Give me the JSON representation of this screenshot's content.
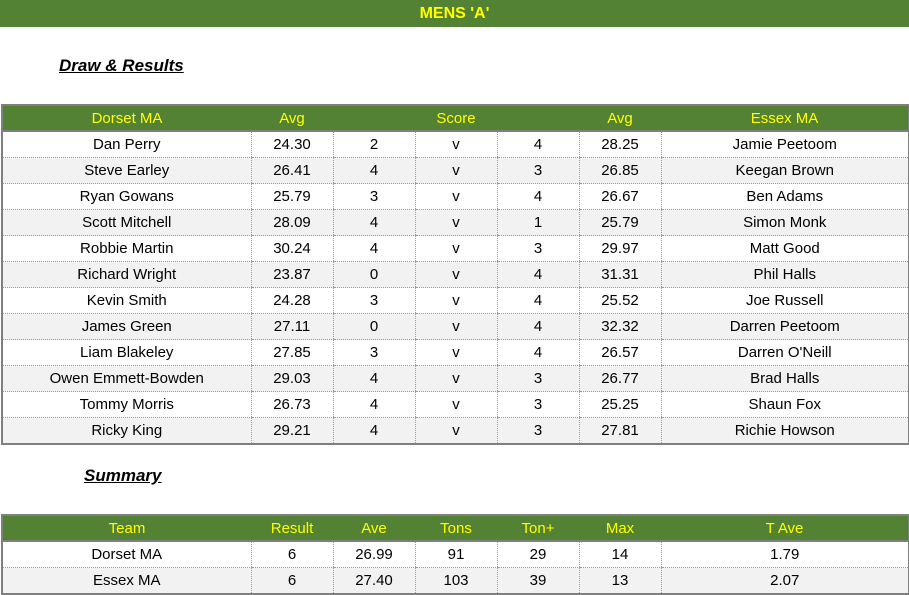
{
  "title": "MENS 'A'",
  "draw_heading": "Draw & Results",
  "summary_heading": "Summary",
  "draw": {
    "headers": [
      "Dorset MA",
      "Avg",
      "Score",
      "Avg",
      "Essex MA"
    ],
    "rows": [
      {
        "home": "Dan Perry",
        "home_avg": "24.30",
        "home_score": "2",
        "v": "v",
        "away_score": "4",
        "away_avg": "28.25",
        "away": "Jamie Peetoom"
      },
      {
        "home": "Steve Earley",
        "home_avg": "26.41",
        "home_score": "4",
        "v": "v",
        "away_score": "3",
        "away_avg": "26.85",
        "away": "Keegan Brown"
      },
      {
        "home": "Ryan Gowans",
        "home_avg": "25.79",
        "home_score": "3",
        "v": "v",
        "away_score": "4",
        "away_avg": "26.67",
        "away": "Ben Adams"
      },
      {
        "home": "Scott Mitchell",
        "home_avg": "28.09",
        "home_score": "4",
        "v": "v",
        "away_score": "1",
        "away_avg": "25.79",
        "away": "Simon Monk"
      },
      {
        "home": "Robbie Martin",
        "home_avg": "30.24",
        "home_score": "4",
        "v": "v",
        "away_score": "3",
        "away_avg": "29.97",
        "away": "Matt Good"
      },
      {
        "home": "Richard Wright",
        "home_avg": "23.87",
        "home_score": "0",
        "v": "v",
        "away_score": "4",
        "away_avg": "31.31",
        "away": "Phil Halls"
      },
      {
        "home": "Kevin Smith",
        "home_avg": "24.28",
        "home_score": "3",
        "v": "v",
        "away_score": "4",
        "away_avg": "25.52",
        "away": "Joe Russell"
      },
      {
        "home": "James Green",
        "home_avg": "27.11",
        "home_score": "0",
        "v": "v",
        "away_score": "4",
        "away_avg": "32.32",
        "away": "Darren Peetoom"
      },
      {
        "home": "Liam Blakeley",
        "home_avg": "27.85",
        "home_score": "3",
        "v": "v",
        "away_score": "4",
        "away_avg": "26.57",
        "away": "Darren O'Neill"
      },
      {
        "home": "Owen Emmett-Bowden",
        "home_avg": "29.03",
        "home_score": "4",
        "v": "v",
        "away_score": "3",
        "away_avg": "26.77",
        "away": "Brad Halls"
      },
      {
        "home": "Tommy Morris",
        "home_avg": "26.73",
        "home_score": "4",
        "v": "v",
        "away_score": "3",
        "away_avg": "25.25",
        "away": "Shaun Fox"
      },
      {
        "home": "Ricky King",
        "home_avg": "29.21",
        "home_score": "4",
        "v": "v",
        "away_score": "3",
        "away_avg": "27.81",
        "away": "Richie Howson"
      }
    ]
  },
  "summary": {
    "headers": [
      "Team",
      "Result",
      "Ave",
      "Tons",
      "Ton+",
      "Max",
      "T Ave"
    ],
    "rows": [
      {
        "team": "Dorset MA",
        "result": "6",
        "ave": "26.99",
        "tons": "91",
        "ton_plus": "29",
        "max": "14",
        "t_ave": "1.79"
      },
      {
        "team": "Essex MA",
        "result": "6",
        "ave": "27.40",
        "tons": "103",
        "ton_plus": "39",
        "max": "13",
        "t_ave": "2.07"
      }
    ]
  },
  "colors": {
    "header_bg": "#548235",
    "header_text": "#ffff00",
    "alt_row": "#f2f2f2"
  }
}
